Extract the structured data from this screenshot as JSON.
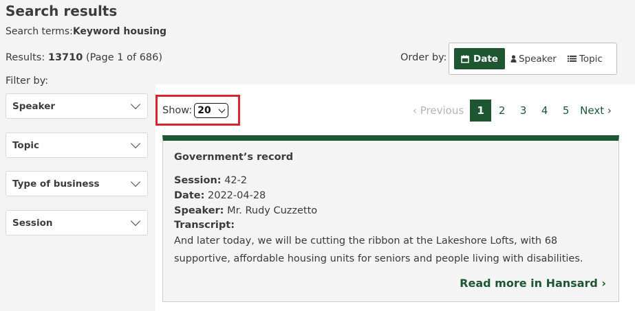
{
  "page": {
    "title": "Search results",
    "search_terms_label": "Search terms:",
    "search_terms_value": "Keyword housing",
    "results_label": "Results:",
    "results_count": "13710",
    "results_page_info": "(Page 1 of 686)",
    "filter_label": "Filter by:"
  },
  "filters": [
    {
      "label": "Speaker"
    },
    {
      "label": "Topic"
    },
    {
      "label": "Type of business"
    },
    {
      "label": "Session"
    }
  ],
  "order": {
    "label": "Order by:",
    "options": [
      {
        "label": "Date",
        "icon": "calendar-icon",
        "active": true
      },
      {
        "label": "Speaker",
        "icon": "person-icon",
        "active": false
      },
      {
        "label": "Topic",
        "icon": "list-icon",
        "active": false
      }
    ]
  },
  "show": {
    "label": "Show:",
    "value": "20"
  },
  "pagination": {
    "prev": "‹ Previous",
    "pages": [
      "1",
      "2",
      "3",
      "4",
      "5"
    ],
    "current": "1",
    "next": "Next ›"
  },
  "result": {
    "title": "Government’s record",
    "session_label": "Session:",
    "session_value": "42-2",
    "date_label": "Date:",
    "date_value": "2022-04-28",
    "speaker_label": "Speaker:",
    "speaker_value": "Mr. Rudy Cuzzetto",
    "transcript_label": "Transcript:",
    "transcript_text": "And later today, we will be cutting the ribbon at the Lakeshore Lofts, with 68 supportive, affordable housing units for seniors and people living with disabilities.",
    "read_more": "Read more in Hansard ›"
  },
  "colors": {
    "brand": "#1e5632",
    "highlight": "#d6252f"
  }
}
